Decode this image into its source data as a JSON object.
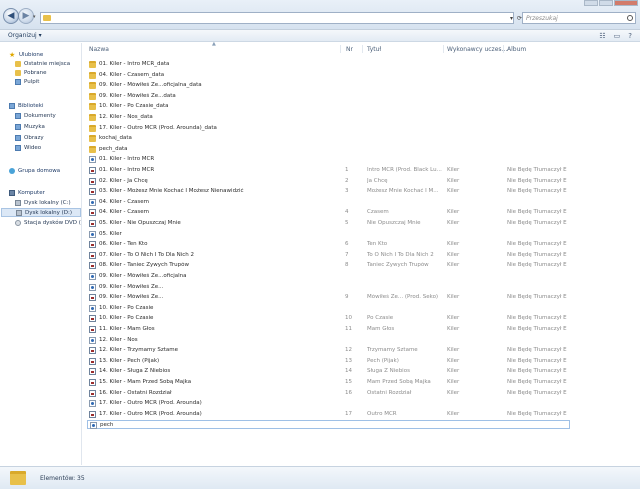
{
  "search": {
    "placeholder": "Przeszukaj"
  },
  "toolbar": {
    "organize_label": "Organizuj ▾"
  },
  "nav": {
    "favorites": {
      "label": "Ulubione",
      "items": [
        "Ostatnie miejsca",
        "Pobrane",
        "Pulpit"
      ]
    },
    "libraries": {
      "label": "Biblioteki",
      "items": [
        "Dokumenty",
        "Muzyka",
        "Obrazy",
        "Wideo"
      ]
    },
    "homegroup": {
      "label": "Grupa domowa"
    },
    "computer": {
      "label": "Komputer",
      "items": [
        "Dysk lokalny (C:)",
        "Dysk lokalny (D:)",
        "Stacja dysków DVD ("
      ]
    }
  },
  "columns": {
    "name": "Nazwa",
    "nr": "Nr",
    "title": "Tytuł",
    "artist": "Wykonawcy uczes...",
    "album": "Album"
  },
  "files": [
    {
      "type": "folder",
      "name": "01. Kiler - Intro MCR_data",
      "nr": "",
      "title": "",
      "artist": "",
      "album": ""
    },
    {
      "type": "folder",
      "name": "04. Kiler - Czasem_data",
      "nr": "",
      "title": "",
      "artist": "",
      "album": ""
    },
    {
      "type": "folder",
      "name": "09. Kiler - Mówiłeś Że...oficjalna_data",
      "nr": "",
      "title": "",
      "artist": "",
      "album": ""
    },
    {
      "type": "folder",
      "name": "09. Kiler - Mówiłeś Że...data",
      "nr": "",
      "title": "",
      "artist": "",
      "album": ""
    },
    {
      "type": "folder",
      "name": "10. Kiler - Po Czasie_data",
      "nr": "",
      "title": "",
      "artist": "",
      "album": ""
    },
    {
      "type": "folder",
      "name": "12. Kiler - Nos_data",
      "nr": "",
      "title": "",
      "artist": "",
      "album": ""
    },
    {
      "type": "folder",
      "name": "17. Kiler - Outro MCR (Prod. Arounda)_data",
      "nr": "",
      "title": "",
      "artist": "",
      "album": ""
    },
    {
      "type": "folder",
      "name": "kochaj_data",
      "nr": "",
      "title": "",
      "artist": "",
      "album": ""
    },
    {
      "type": "folder",
      "name": "pech_data",
      "nr": "",
      "title": "",
      "artist": "",
      "album": ""
    },
    {
      "type": "audio",
      "name": "01. Kiler - Intro MCR",
      "nr": "",
      "title": "",
      "artist": "",
      "album": ""
    },
    {
      "type": "mp3",
      "name": "01. Kiler - Intro MCR",
      "nr": "1",
      "title": "Intro MCR (Prod. Black Lu...",
      "artist": "Kiler",
      "album": "Nie Będę Tłumaczył Ei..."
    },
    {
      "type": "mp3",
      "name": "02. Kiler - Ja Chcę",
      "nr": "2",
      "title": "Ja Chcę",
      "artist": "Kiler",
      "album": "Nie Będę Tłumaczył Ei..."
    },
    {
      "type": "mp3",
      "name": "03. Kiler - Możesz Mnie Kochać I Możesz Nienawidzić",
      "nr": "3",
      "title": "Możesz Mnie Kochać I M...",
      "artist": "Kiler",
      "album": "Nie Będę Tłumaczył Ei..."
    },
    {
      "type": "audio",
      "name": "04. Kiler - Czasem",
      "nr": "",
      "title": "",
      "artist": "",
      "album": ""
    },
    {
      "type": "mp3",
      "name": "04. Kiler - Czasem",
      "nr": "4",
      "title": "Czasem",
      "artist": "Kiler",
      "album": "Nie Będę Tłumaczył Ei..."
    },
    {
      "type": "mp3",
      "name": "05. Kiler - Nie Opuszczaj Mnie",
      "nr": "5",
      "title": "Nie Opuszczaj Mnie",
      "artist": "Kiler",
      "album": "Nie Będę Tłumaczył Ei..."
    },
    {
      "type": "audio",
      "name": "05. Kiler",
      "nr": "",
      "title": "",
      "artist": "",
      "album": ""
    },
    {
      "type": "mp3",
      "name": "06. Kiler - Ten Kto",
      "nr": "6",
      "title": "Ten Kto",
      "artist": "Kiler",
      "album": "Nie Będę Tłumaczył Ei..."
    },
    {
      "type": "mp3",
      "name": "07. Kiler - To O Nich I To Dla Nich 2",
      "nr": "7",
      "title": "To O Nich I To Dla Nich 2",
      "artist": "Kiler",
      "album": "Nie Będę Tłumaczył Ei..."
    },
    {
      "type": "mp3",
      "name": "08. Kiler - Taniec Żywych Trupów",
      "nr": "8",
      "title": "Taniec Żywych Trupów",
      "artist": "Kiler",
      "album": "Nie Będę Tłumaczył Ei..."
    },
    {
      "type": "audio",
      "name": "09. Kiler - Mówiłeś Że...oficjalna",
      "nr": "",
      "title": "",
      "artist": "",
      "album": ""
    },
    {
      "type": "audio",
      "name": "09. Kiler - Mówiłeś Że...",
      "nr": "",
      "title": "",
      "artist": "",
      "album": ""
    },
    {
      "type": "mp3",
      "name": "09. Kiler - Mówiłeś Że...",
      "nr": "9",
      "title": "Mówiłeś Że... (Prod. Seko)",
      "artist": "Kiler",
      "album": "Nie Będę Tłumaczył Ei..."
    },
    {
      "type": "audio",
      "name": "10. Kiler - Po Czasie",
      "nr": "",
      "title": "",
      "artist": "",
      "album": ""
    },
    {
      "type": "mp3",
      "name": "10. Kiler - Po Czasie",
      "nr": "10",
      "title": "Po Czasie",
      "artist": "Kiler",
      "album": "Nie Będę Tłumaczył Ei..."
    },
    {
      "type": "mp3",
      "name": "11. Kiler - Mam Głos",
      "nr": "11",
      "title": "Mam Głos",
      "artist": "Kiler",
      "album": "Nie Będę Tłumaczył Ei..."
    },
    {
      "type": "audio",
      "name": "12. Kiler - Nos",
      "nr": "",
      "title": "",
      "artist": "",
      "album": ""
    },
    {
      "type": "mp3",
      "name": "12. Kiler - Trzymamy Sztame",
      "nr": "12",
      "title": "Trzymamy Sztame",
      "artist": "Kiler",
      "album": "Nie Będę Tłumaczył Ei..."
    },
    {
      "type": "mp3",
      "name": "13. Kiler - Pech (Pijak)",
      "nr": "13",
      "title": "Pech (Pijak)",
      "artist": "Kiler",
      "album": "Nie Będę Tłumaczył Ei..."
    },
    {
      "type": "mp3",
      "name": "14. Kiler - Sługa Z Niebios",
      "nr": "14",
      "title": "Sługa Z Niebios",
      "artist": "Kiler",
      "album": "Nie Będę Tłumaczył Ei..."
    },
    {
      "type": "mp3",
      "name": "15. Kiler - Mam Przed Sobą Majka",
      "nr": "15",
      "title": "Mam Przed Sobą Majka",
      "artist": "Kiler",
      "album": "Nie Będę Tłumaczył Ei..."
    },
    {
      "type": "mp3",
      "name": "16. Kiler - Ostatni Rozdział",
      "nr": "16",
      "title": "Ostatni Rozdział",
      "artist": "Kiler",
      "album": "Nie Będę Tłumaczył Ei..."
    },
    {
      "type": "audio",
      "name": "17. Kiler - Outro MCR (Prod. Arounda)",
      "nr": "",
      "title": "",
      "artist": "",
      "album": ""
    },
    {
      "type": "mp3",
      "name": "17. Kiler - Outro MCR (Prod. Arounda)",
      "nr": "17",
      "title": "Outro MCR",
      "artist": "Kiler",
      "album": "Nie Będę Tłumaczył Ei..."
    },
    {
      "type": "audio",
      "name": "pech",
      "nr": "",
      "title": "",
      "artist": "",
      "album": ""
    }
  ],
  "status": {
    "count_text": "Elementów: 35"
  }
}
